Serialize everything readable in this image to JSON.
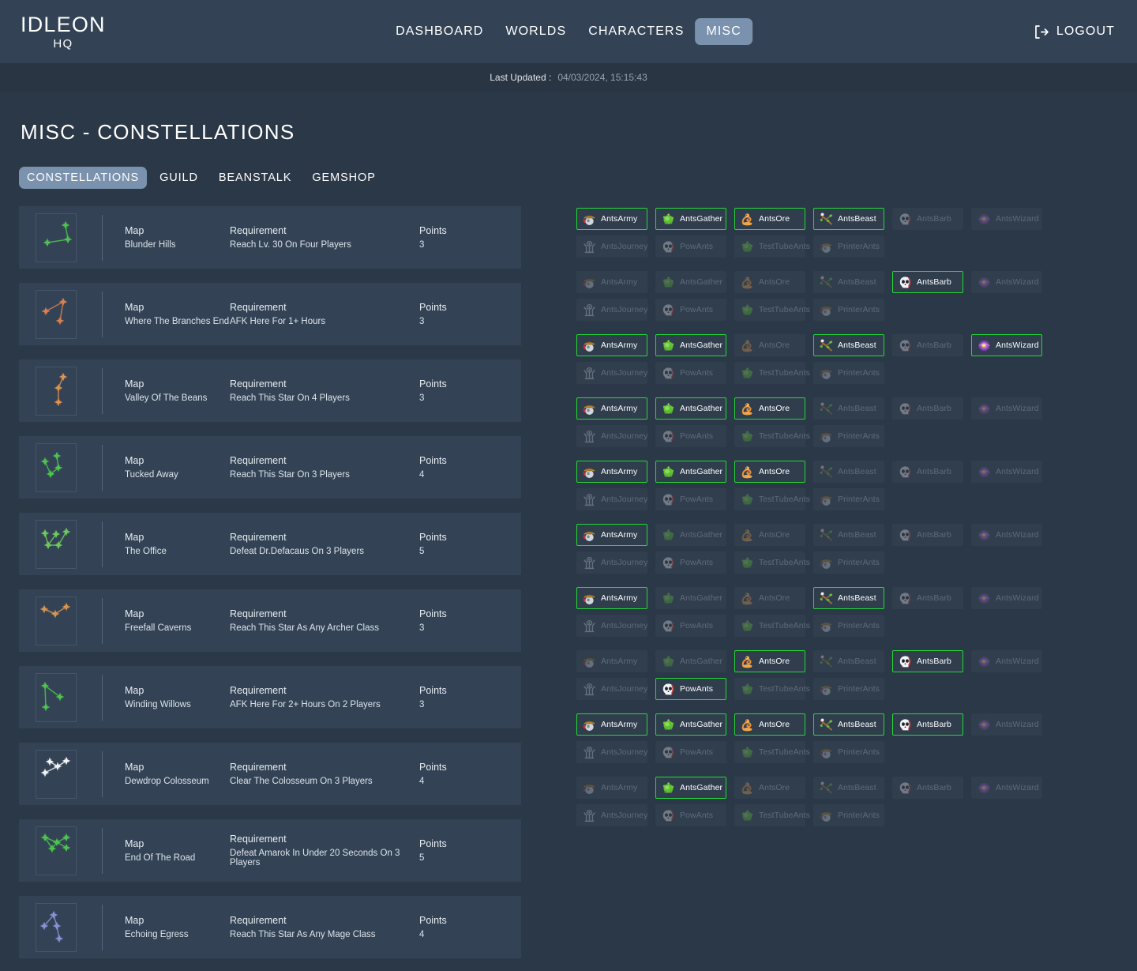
{
  "header": {
    "brand_main": "IDLEON",
    "brand_sub": "HQ",
    "nav": [
      {
        "label": "DASHBOARD",
        "active": false
      },
      {
        "label": "WORLDS",
        "active": false
      },
      {
        "label": "CHARACTERS",
        "active": false
      },
      {
        "label": "MISC",
        "active": true
      }
    ],
    "logout_label": "LOGOUT",
    "last_updated_label": "Last Updated :",
    "last_updated_value": "04/03/2024, 15:15:43"
  },
  "page": {
    "title": "MISC - CONSTELLATIONS",
    "tabs": [
      {
        "label": "CONSTELLATIONS",
        "active": true
      },
      {
        "label": "GUILD",
        "active": false
      },
      {
        "label": "BEANSTALK",
        "active": false
      },
      {
        "label": "GEMSHOP",
        "active": false
      }
    ],
    "column_headers": {
      "map": "Map",
      "requirement": "Requirement",
      "points": "Points"
    }
  },
  "constellations": [
    {
      "map": "Blunder Hills",
      "requirement": "Reach Lv. 30 On Four Players",
      "points": "3",
      "star_color": "#4ec44e",
      "stars": [
        [
          37,
          14
        ],
        [
          40,
          32
        ],
        [
          14,
          36
        ]
      ],
      "links": [
        [
          0,
          1
        ],
        [
          1,
          2
        ]
      ]
    },
    {
      "map": "Where The Branches End",
      "requirement": "AFK Here For 1+ Hours",
      "points": "3",
      "star_color": "#d9804f",
      "stars": [
        [
          34,
          14
        ],
        [
          12,
          26
        ],
        [
          30,
          38
        ]
      ],
      "links": [
        [
          0,
          1
        ],
        [
          0,
          2
        ]
      ]
    },
    {
      "map": "Valley Of The Beans",
      "requirement": "Reach This Star On 4 Players",
      "points": "3",
      "star_color": "#e0924f",
      "stars": [
        [
          34,
          12
        ],
        [
          28,
          26
        ],
        [
          28,
          44
        ]
      ],
      "links": [
        [
          0,
          1
        ],
        [
          1,
          2
        ]
      ]
    },
    {
      "map": "Tucked Away",
      "requirement": "Reach This Star On 3 Players",
      "points": "4",
      "star_color": "#4ec44e",
      "stars": [
        [
          26,
          15
        ],
        [
          11,
          22
        ],
        [
          28,
          30
        ],
        [
          18,
          38
        ]
      ],
      "links": [
        [
          0,
          2
        ],
        [
          1,
          3
        ],
        [
          2,
          3
        ]
      ]
    },
    {
      "map": "The Office",
      "requirement": "Defeat Dr.Defacaus On 3 Players",
      "points": "5",
      "star_color": "#6ecb5e",
      "stars": [
        [
          11,
          16
        ],
        [
          25,
          17
        ],
        [
          38,
          14
        ],
        [
          15,
          31
        ],
        [
          28,
          31
        ]
      ],
      "links": [
        [
          0,
          3
        ],
        [
          1,
          3
        ],
        [
          3,
          4
        ],
        [
          4,
          2
        ]
      ]
    },
    {
      "map": "Freefall Caverns",
      "requirement": "Reach This Star As Any Archer Class",
      "points": "3",
      "star_color": "#d9954f",
      "stars": [
        [
          10,
          15
        ],
        [
          24,
          21
        ],
        [
          38,
          12
        ]
      ],
      "links": [
        [
          0,
          1
        ],
        [
          1,
          2
        ]
      ]
    },
    {
      "map": "Winding Willows",
      "requirement": "AFK Here For 2+ Hours On 2 Players",
      "points": "3",
      "star_color": "#4ec44e",
      "stars": [
        [
          11,
          15
        ],
        [
          30,
          29
        ],
        [
          12,
          42
        ]
      ],
      "links": [
        [
          0,
          1
        ],
        [
          0,
          2
        ]
      ]
    },
    {
      "map": "Dewdrop Colosseum",
      "requirement": "Clear The Colosseum On 3 Players",
      "points": "4",
      "star_color": "#f2f4f7",
      "stars": [
        [
          17,
          14
        ],
        [
          27,
          20
        ],
        [
          38,
          13
        ],
        [
          11,
          28
        ]
      ],
      "links": [
        [
          0,
          1
        ],
        [
          1,
          2
        ],
        [
          1,
          3
        ]
      ]
    },
    {
      "map": "End Of The Road",
      "requirement": "Defeat Amarok In Under 20 Seconds On 3 Players",
      "points": "5",
      "star_color": "#4ec44e",
      "stars": [
        [
          11,
          13
        ],
        [
          26,
          19
        ],
        [
          38,
          13
        ],
        [
          20,
          27
        ],
        [
          38,
          26
        ]
      ],
      "links": [
        [
          0,
          3
        ],
        [
          0,
          1
        ],
        [
          1,
          2
        ],
        [
          1,
          4
        ],
        [
          3,
          1
        ]
      ]
    },
    {
      "map": "Echoing Egress",
      "requirement": "Reach This Star As Any Mage Class",
      "points": "4",
      "star_color": "#8e8fd4",
      "stars": [
        [
          22,
          14
        ],
        [
          10,
          28
        ],
        [
          26,
          28
        ],
        [
          29,
          44
        ]
      ],
      "links": [
        [
          0,
          1
        ],
        [
          0,
          2
        ],
        [
          2,
          3
        ]
      ]
    }
  ],
  "ant_names": {
    "army": "AntsArmy",
    "gather": "AntsGather",
    "ore": "AntsOre",
    "beast": "AntsBeast",
    "barb": "AntsBarb",
    "wizard": "AntsWizard",
    "journey": "AntsJourney",
    "pow": "PowAnts",
    "testtube": "TestTubeAnts",
    "printer": "PrinterAnts"
  },
  "ant_row_top": [
    "army",
    "gather",
    "ore",
    "beast",
    "barb",
    "wizard"
  ],
  "ant_row_bottom": [
    "journey",
    "pow",
    "testtube",
    "printer"
  ],
  "ant_groups": [
    {
      "top": [
        true,
        true,
        true,
        true,
        false,
        false
      ],
      "bottom": [
        false,
        false,
        false,
        false
      ]
    },
    {
      "top": [
        false,
        false,
        false,
        false,
        true,
        false
      ],
      "bottom": [
        false,
        false,
        false,
        false
      ]
    },
    {
      "top": [
        true,
        true,
        false,
        true,
        false,
        true
      ],
      "bottom": [
        false,
        false,
        false,
        false
      ]
    },
    {
      "top": [
        true,
        true,
        true,
        false,
        false,
        false
      ],
      "bottom": [
        false,
        false,
        false,
        false
      ]
    },
    {
      "top": [
        true,
        true,
        true,
        false,
        false,
        false
      ],
      "bottom": [
        false,
        false,
        false,
        false
      ]
    },
    {
      "top": [
        true,
        false,
        false,
        false,
        false,
        false
      ],
      "bottom": [
        false,
        false,
        false,
        false
      ]
    },
    {
      "top": [
        true,
        false,
        false,
        true,
        false,
        false
      ],
      "bottom": [
        false,
        false,
        false,
        false
      ]
    },
    {
      "top": [
        false,
        false,
        true,
        false,
        true,
        false
      ],
      "bottom": [
        false,
        true,
        false,
        false
      ]
    },
    {
      "top": [
        true,
        true,
        true,
        true,
        true,
        false
      ],
      "bottom": [
        false,
        false,
        false,
        false
      ]
    },
    {
      "top": [
        false,
        true,
        false,
        false,
        false,
        false
      ],
      "bottom": [
        false,
        false,
        false,
        false
      ]
    }
  ],
  "colors": {
    "page_bg": "#2b3847",
    "header_bg": "#334355",
    "subbar_bg": "#293543",
    "card_bg": "#334355",
    "accent_pill": "#7a92ad",
    "active_border": "#24d836"
  }
}
